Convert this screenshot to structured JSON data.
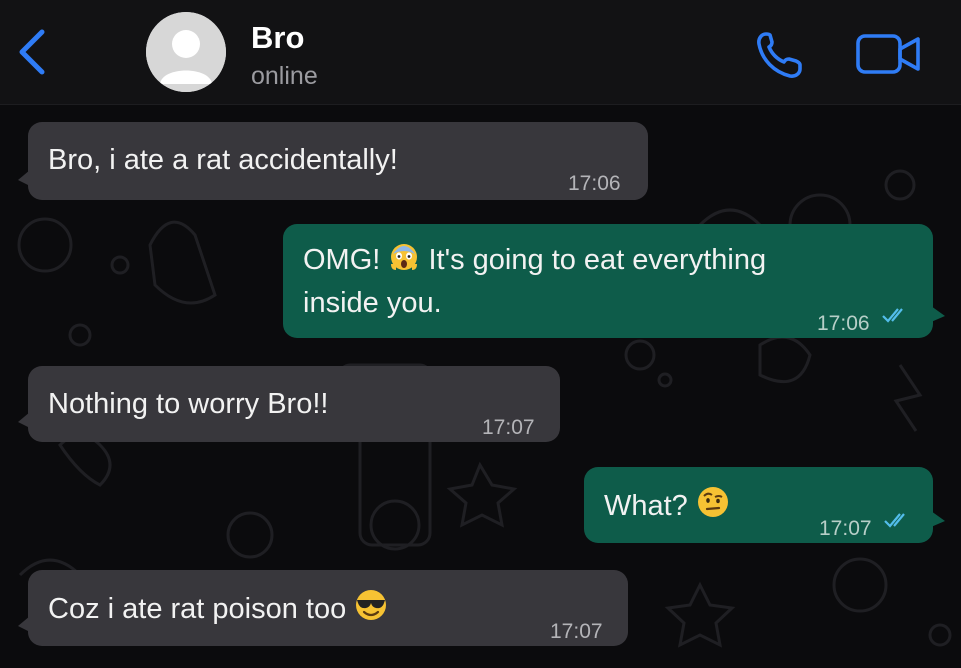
{
  "header": {
    "contact_name": "Bro",
    "status": "online"
  },
  "messages": [
    {
      "direction": "incoming",
      "text": "Bro, i ate a rat accidentally!",
      "time": "17:06"
    },
    {
      "direction": "outgoing",
      "text_part1": "OMG!",
      "emoji1": "screaming-face-emoji",
      "text_part2": "It's going to eat everything",
      "text_line2": "inside you.",
      "time": "17:06",
      "status": "read"
    },
    {
      "direction": "incoming",
      "text": "Nothing to worry Bro!!",
      "time": "17:07"
    },
    {
      "direction": "outgoing",
      "text": "What?",
      "emoji": "face-with-raised-eyebrow-emoji",
      "time": "17:07",
      "status": "read"
    },
    {
      "direction": "incoming",
      "text": "Coz i ate rat poison too",
      "emoji": "smiling-face-with-sunglasses-emoji",
      "time": "17:07"
    }
  ],
  "colors": {
    "accent": "#2f7cf6",
    "incoming_bubble": "#38373c",
    "outgoing_bubble": "#0e5c4a",
    "read_ticks": "#53bdeb",
    "background": "#0b0b0d"
  }
}
